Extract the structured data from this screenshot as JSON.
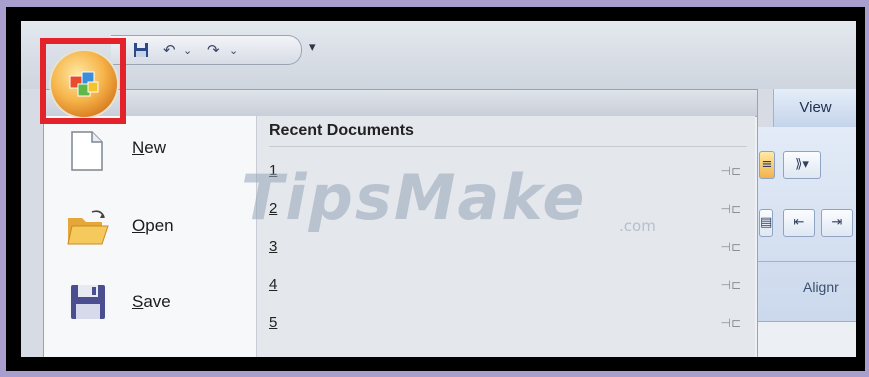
{
  "watermark": {
    "text": "TipsMake",
    "suffix": ".com"
  },
  "quick_access": {
    "save_icon": "save-icon",
    "undo_icon": "undo-icon",
    "redo_icon": "redo-icon",
    "customize_glyph": "▾",
    "undo_glyph": "↶",
    "redo_glyph": "↷",
    "arrow_glyph": "⌄"
  },
  "ribbon": {
    "tab_view": "View",
    "group_label": "Alignr",
    "buttons": [
      "≡",
      "⟫▾",
      "▤",
      "⇤",
      "⇥"
    ]
  },
  "menu": {
    "commands": [
      {
        "label": "New",
        "icon": "new-document-icon"
      },
      {
        "label": "Open",
        "icon": "folder-open-icon"
      },
      {
        "label": "Save",
        "icon": "floppy-save-icon"
      }
    ],
    "recent": {
      "title": "Recent Documents",
      "items": [
        "1",
        "2",
        "3",
        "4",
        "5"
      ],
      "pin_glyph": "⊣⊏"
    }
  },
  "highlight_color": "#e3222a"
}
